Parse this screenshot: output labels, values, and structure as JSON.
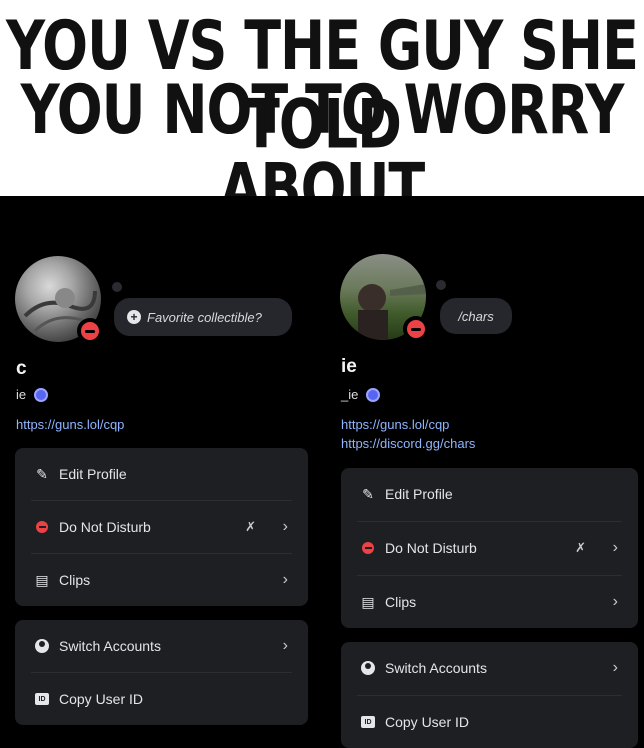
{
  "caption": {
    "line1": "YOU VS THE GUY SHE TOLD",
    "line2": "YOU NOT TO WORRY ABOUT"
  },
  "left_profile": {
    "display_name": "c",
    "username": "ie",
    "status_bubble": "Favorite collectible?",
    "links": [
      "https://guns.lol/cqp"
    ],
    "menu_main": [
      {
        "label": "Edit Profile",
        "icon": "pencil-icon"
      },
      {
        "label": "Do Not Disturb",
        "icon": "dnd-icon"
      },
      {
        "label": "Clips",
        "icon": "clapperboard-icon"
      }
    ],
    "menu_account": [
      {
        "label": "Switch Accounts",
        "icon": "user-circle-icon"
      },
      {
        "label": "Copy User ID",
        "icon": "id-icon"
      }
    ]
  },
  "right_profile": {
    "display_name": "ie",
    "username": "_ie",
    "status_bubble": "/chars",
    "links": [
      "https://guns.lol/cqp",
      "https://discord.gg/chars"
    ],
    "menu_main": [
      {
        "label": "Edit Profile",
        "icon": "pencil-icon"
      },
      {
        "label": "Do Not Disturb",
        "icon": "dnd-icon"
      },
      {
        "label": "Clips",
        "icon": "clapperboard-icon"
      }
    ],
    "menu_account": [
      {
        "label": "Switch Accounts",
        "icon": "user-circle-icon"
      },
      {
        "label": "Copy User ID",
        "icon": "id-icon"
      }
    ]
  },
  "colors": {
    "background": "#000000",
    "card": "#1e1f23",
    "link": "#8fb5ff",
    "dnd_red": "#ed4245"
  }
}
